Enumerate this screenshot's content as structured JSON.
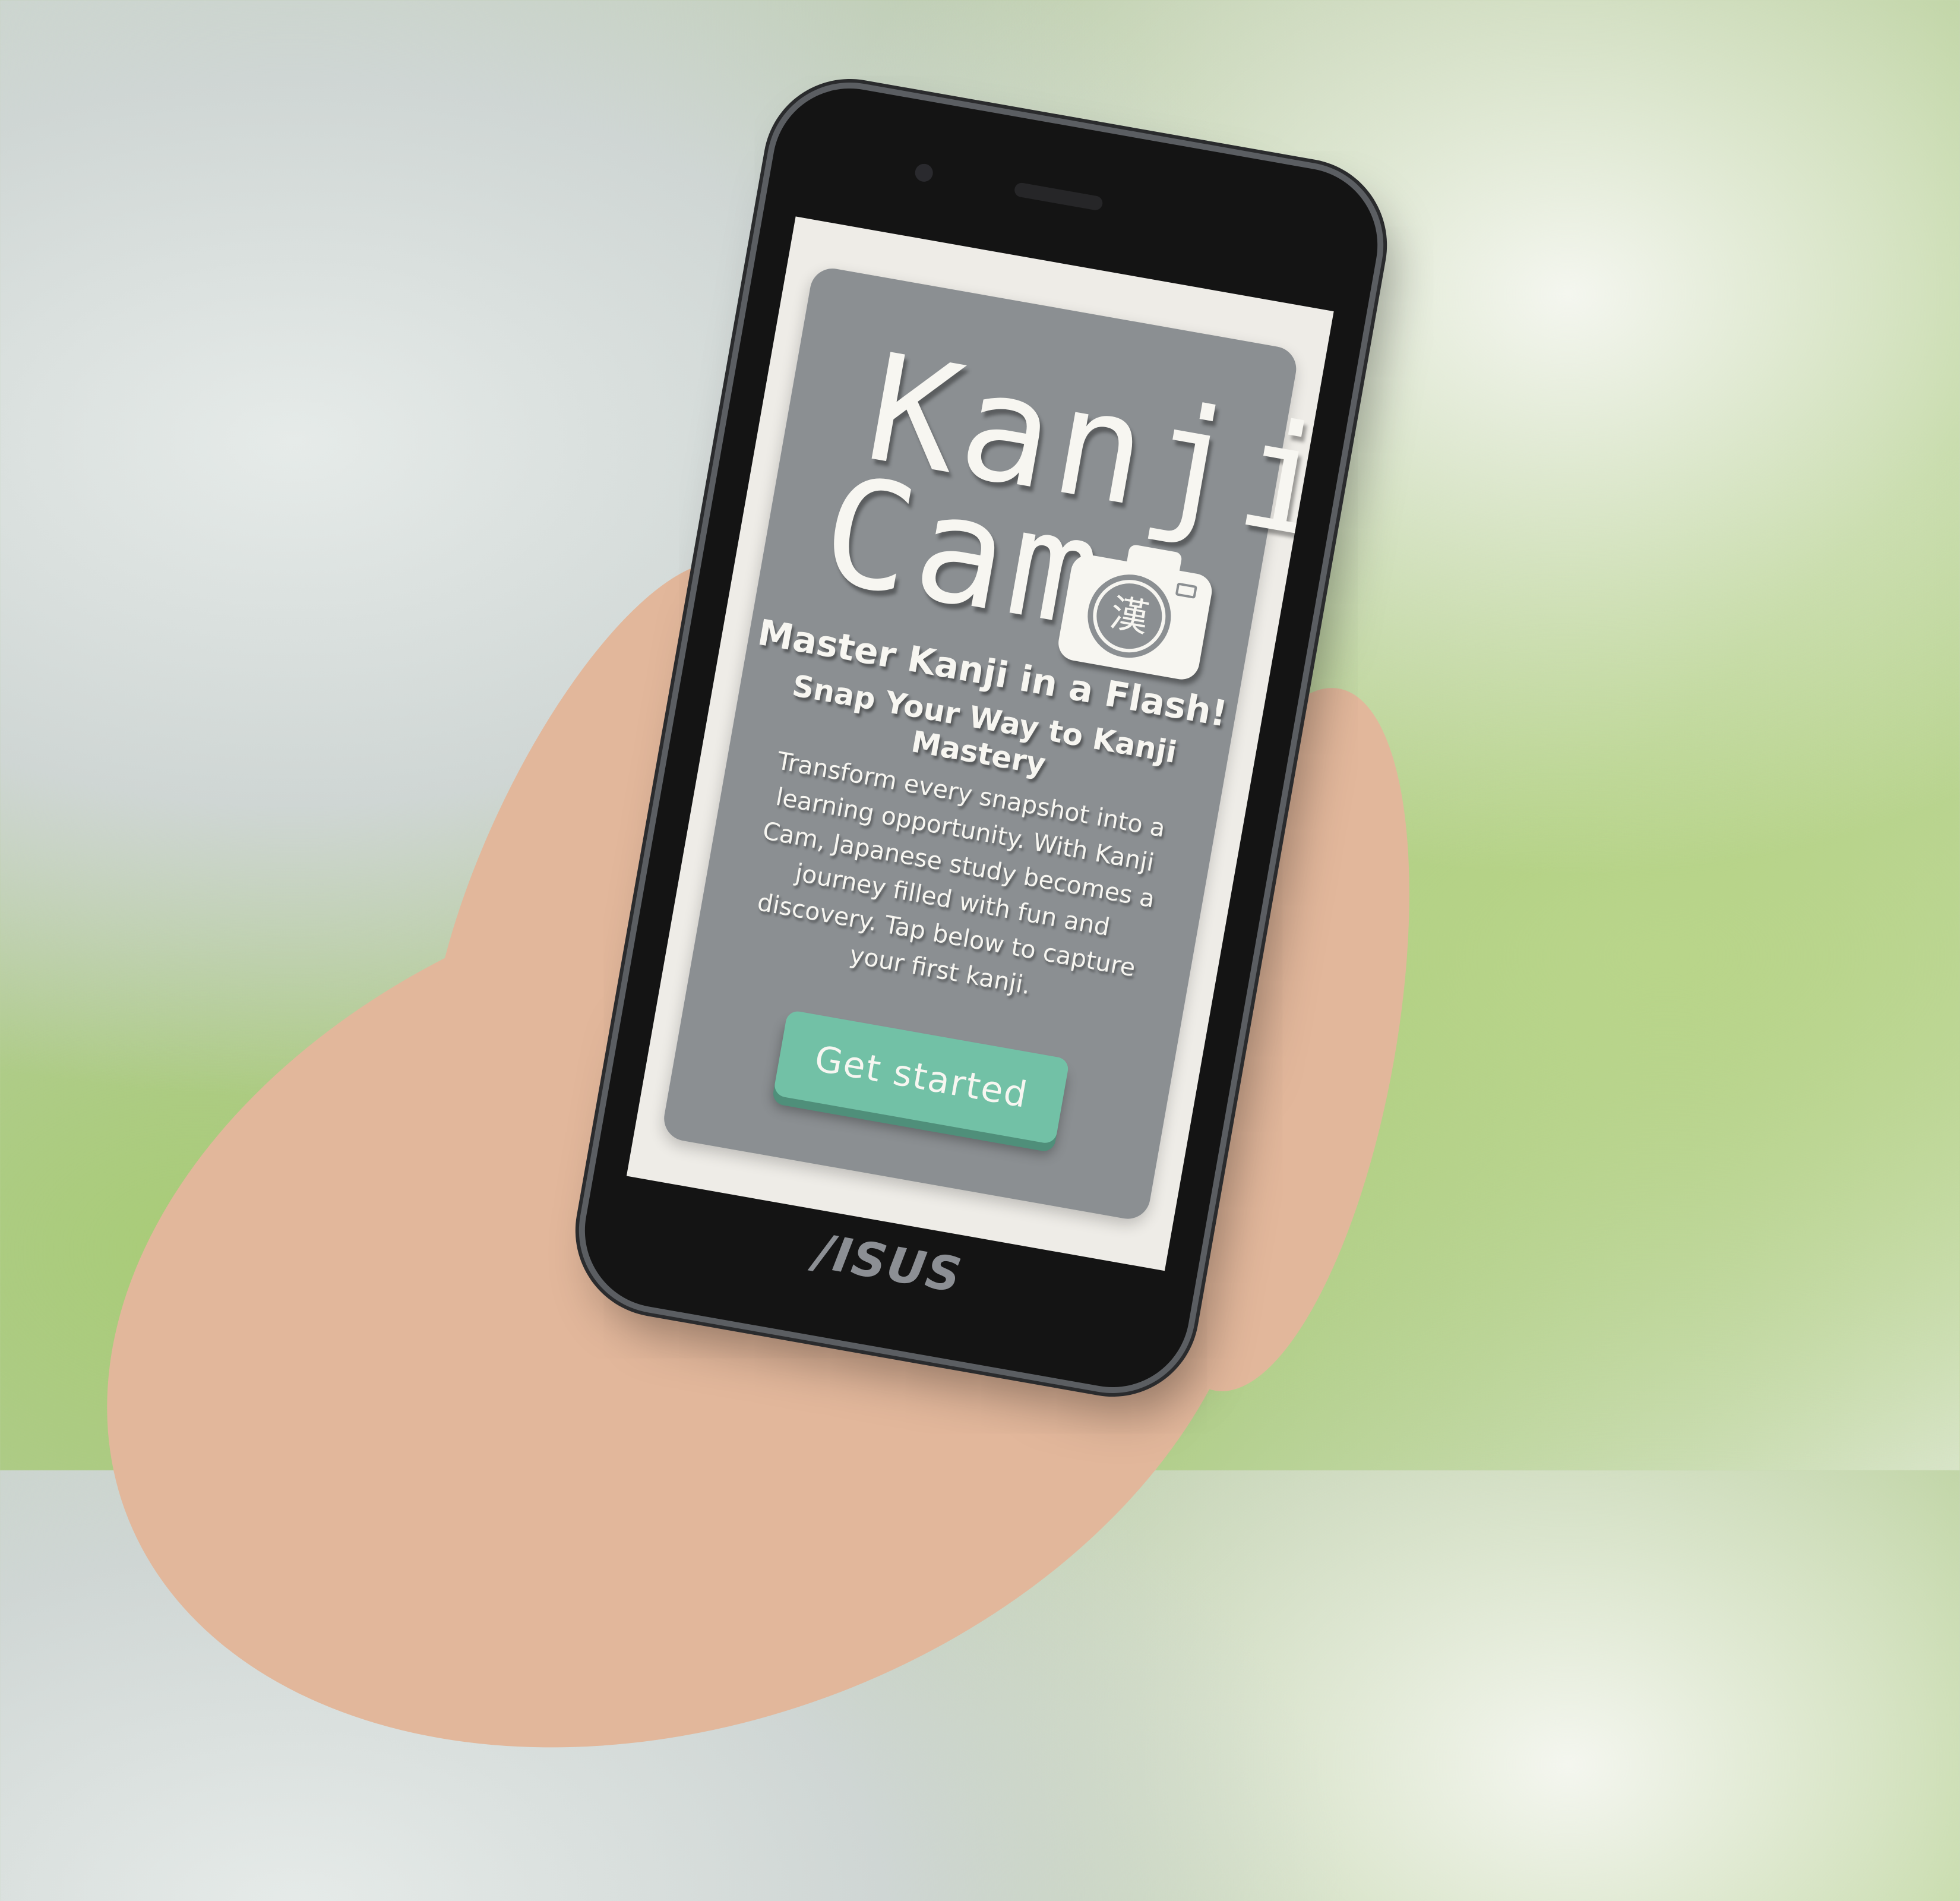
{
  "app": {
    "logo": {
      "line1": "Kanji",
      "line2": "Cam",
      "camera_glyph": "漢"
    },
    "headline": "Master Kanji in a Flash!",
    "subheadline": "Snap Your Way to Kanji Mastery",
    "description": "Transform every snapshot into a learning opportunity. With Kanji Cam, Japanese study becomes a journey filled with fun and discovery. Tap below to capture your first kanji.",
    "cta_label": "Get started"
  },
  "device": {
    "brand": "/ISUS"
  },
  "colors": {
    "card": "#8b8f92",
    "button": "#72c1a6",
    "screen_bg": "#eeece7",
    "text": "#f7f6f1"
  }
}
